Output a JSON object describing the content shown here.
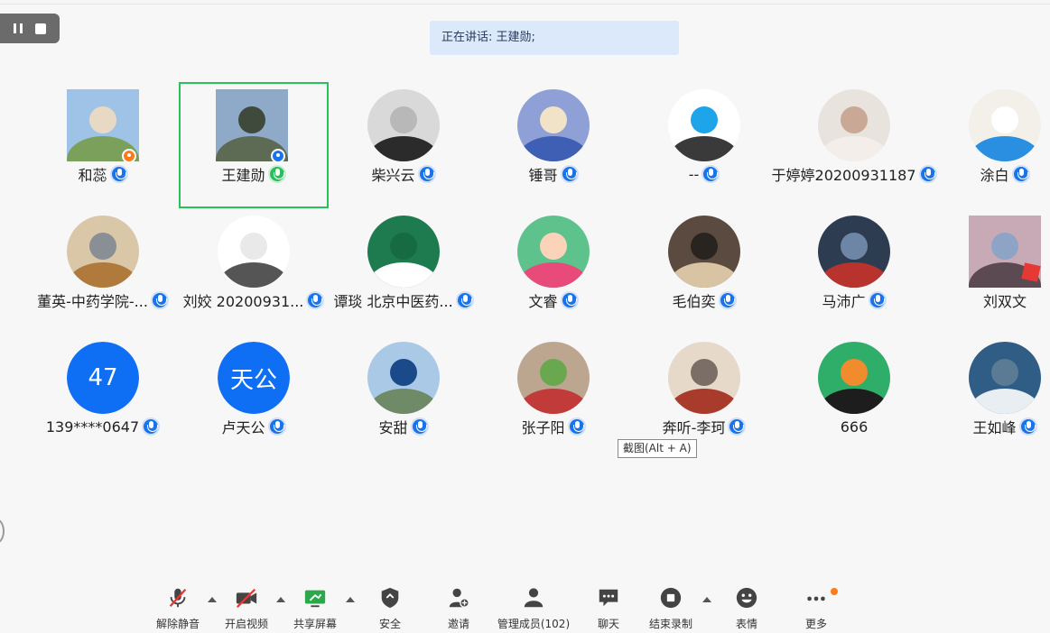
{
  "recording_controls": {
    "pause_icon": "pause-icon",
    "stop_icon": "stop-icon"
  },
  "speaking_banner": "正在讲话: 王建勋;",
  "participants": [
    {
      "name": "和蕊",
      "avatar": "photo-woman-outdoor",
      "mic": "on"
    },
    {
      "name": "王建勋",
      "avatar": "photo-mountain",
      "mic": "speaking",
      "active": true
    },
    {
      "name": "柴兴云",
      "avatar": "photo-person-desk",
      "mic": "on"
    },
    {
      "name": "锤哥",
      "avatar": "illustration-binoculars",
      "mic": "on"
    },
    {
      "name": "--",
      "avatar": "cartoon-glasses-face",
      "mic": "on"
    },
    {
      "name": "于婷婷20200931187",
      "avatar": "photo-doll",
      "mic": "on"
    },
    {
      "name": "涂白",
      "avatar": "doraemon",
      "mic": "on"
    },
    {
      "name": "董英-中药学院-...",
      "avatar": "photo-monkey",
      "mic": "on"
    },
    {
      "name": "刘姣 20200931...",
      "avatar": "sketch-drawing",
      "mic": "on"
    },
    {
      "name": "谭琰 北京中医药...",
      "avatar": "keep-calm-poster",
      "mic": "on"
    },
    {
      "name": "文睿",
      "avatar": "cartoon-pink-hood",
      "mic": "on"
    },
    {
      "name": "毛伯奕",
      "avatar": "photo-man-office",
      "mic": "on"
    },
    {
      "name": "马沛广",
      "avatar": "robot-transformer",
      "mic": "on"
    },
    {
      "name": "刘双文",
      "avatar": "photo-blossom",
      "mic": "none"
    },
    {
      "name": "139****0647",
      "avatar": "text",
      "avatar_text": "47",
      "mic": "on"
    },
    {
      "name": "卢天公",
      "avatar": "text",
      "avatar_text": "天公",
      "mic": "on"
    },
    {
      "name": "安甜",
      "avatar": "photo-jumping-beach",
      "mic": "on"
    },
    {
      "name": "张子阳",
      "avatar": "photo-street-sign",
      "mic": "on"
    },
    {
      "name": "奔听-李珂",
      "avatar": "photo-biplanes",
      "mic": "on"
    },
    {
      "name": "666",
      "avatar": "anime-goku",
      "mic": "none"
    },
    {
      "name": "王如峰",
      "avatar": "photo-clouds-aerial",
      "mic": "on"
    }
  ],
  "tooltip": "截图(Alt + A)",
  "toolbar": {
    "unmute": "解除静音",
    "start_video": "开启视频",
    "share_screen": "共享屏幕",
    "security": "安全",
    "invite": "邀请",
    "manage_members": "管理成员(102)",
    "chat": "聊天",
    "end_recording": "结束录制",
    "reactions": "表情",
    "more": "更多"
  },
  "colors": {
    "accent": "#1a73e8",
    "speaking": "#2bbf5c",
    "active_border": "#27c25a",
    "banner_bg": "#dbe9fb",
    "notify": "#ff7a1a",
    "text_avatar": "#0e6ff5"
  }
}
